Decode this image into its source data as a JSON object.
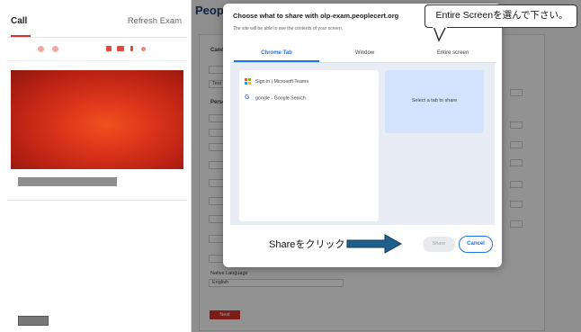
{
  "call_panel": {
    "tab_label": "Call",
    "refresh_label": "Refresh Exam"
  },
  "exam_form": {
    "logo_text": "People",
    "section_titles": [
      "Cand",
      "Perso"
    ],
    "field_values": [
      "Test",
      "English"
    ],
    "language_label": "Native Language",
    "next_label": "Next"
  },
  "share_dialog": {
    "title": "Choose what to share with olp-exam.peoplecert.org",
    "subtitle": "The site will be able to see the contents of your screen.",
    "tabs": [
      {
        "label": "Chrome Tab",
        "active": true
      },
      {
        "label": "Window",
        "active": false
      },
      {
        "label": "Entire screen",
        "active": false
      }
    ],
    "tab_items": [
      {
        "icon": "microsoft-icon",
        "label": "Sign in | Microsoft Teams"
      },
      {
        "icon": "google-icon",
        "label": "google - Google Search"
      }
    ],
    "preview_text": "Select a tab to share",
    "share_label": "Share",
    "cancel_label": "Cancel"
  },
  "annotations": {
    "callout_text": "Entire Screenを選んで下さい。",
    "share_hint": "Shareをクリック"
  },
  "colors": {
    "accent": "#1a73e8",
    "brand_red": "#d8322b",
    "video": "#d8321a"
  }
}
